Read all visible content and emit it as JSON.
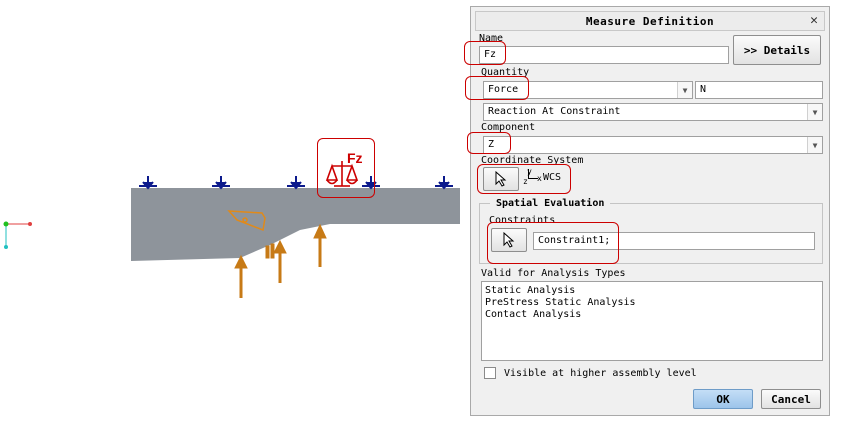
{
  "viewport": {
    "load_label": "Fz"
  },
  "dialog": {
    "title": "Measure Definition",
    "close_glyph": "✕",
    "name": {
      "label": "Name",
      "value": "Fz"
    },
    "details_button": ">> Details",
    "quantity": {
      "label": "Quantity",
      "value": "Force",
      "unit": "N",
      "subtype": "Reaction At Constraint"
    },
    "component": {
      "label": "Component",
      "value": "Z"
    },
    "coordinate_system": {
      "label": "Coordinate System",
      "axis_y": "y",
      "axis_z": "z",
      "axis_x": "x",
      "value": "WCS"
    },
    "spatial_evaluation": {
      "label": "Spatial Evaluation",
      "constraints_label": "Constraints",
      "constraints_value": "Constraint1;"
    },
    "analysis_types": {
      "label": "Valid for Analysis Types",
      "items": [
        "Static Analysis",
        "PreStress Static Analysis",
        "Contact Analysis"
      ]
    },
    "visible_checkbox": {
      "label": "Visible at higher assembly level",
      "checked": false
    },
    "ok_button": "OK",
    "cancel_button": "Cancel"
  },
  "colors": {
    "model_fill": "#8e949b",
    "constraint_blue": "#0c1a8c",
    "load_arrow": "#c77a16",
    "highlight_red": "#cc0000",
    "ok_button": "#9cc4ea"
  },
  "icons": [
    "cursor-icon",
    "constraint-icon",
    "balance-icon",
    "csys-icon",
    "close-icon",
    "chevron-down-icon",
    "tag-icon"
  ]
}
